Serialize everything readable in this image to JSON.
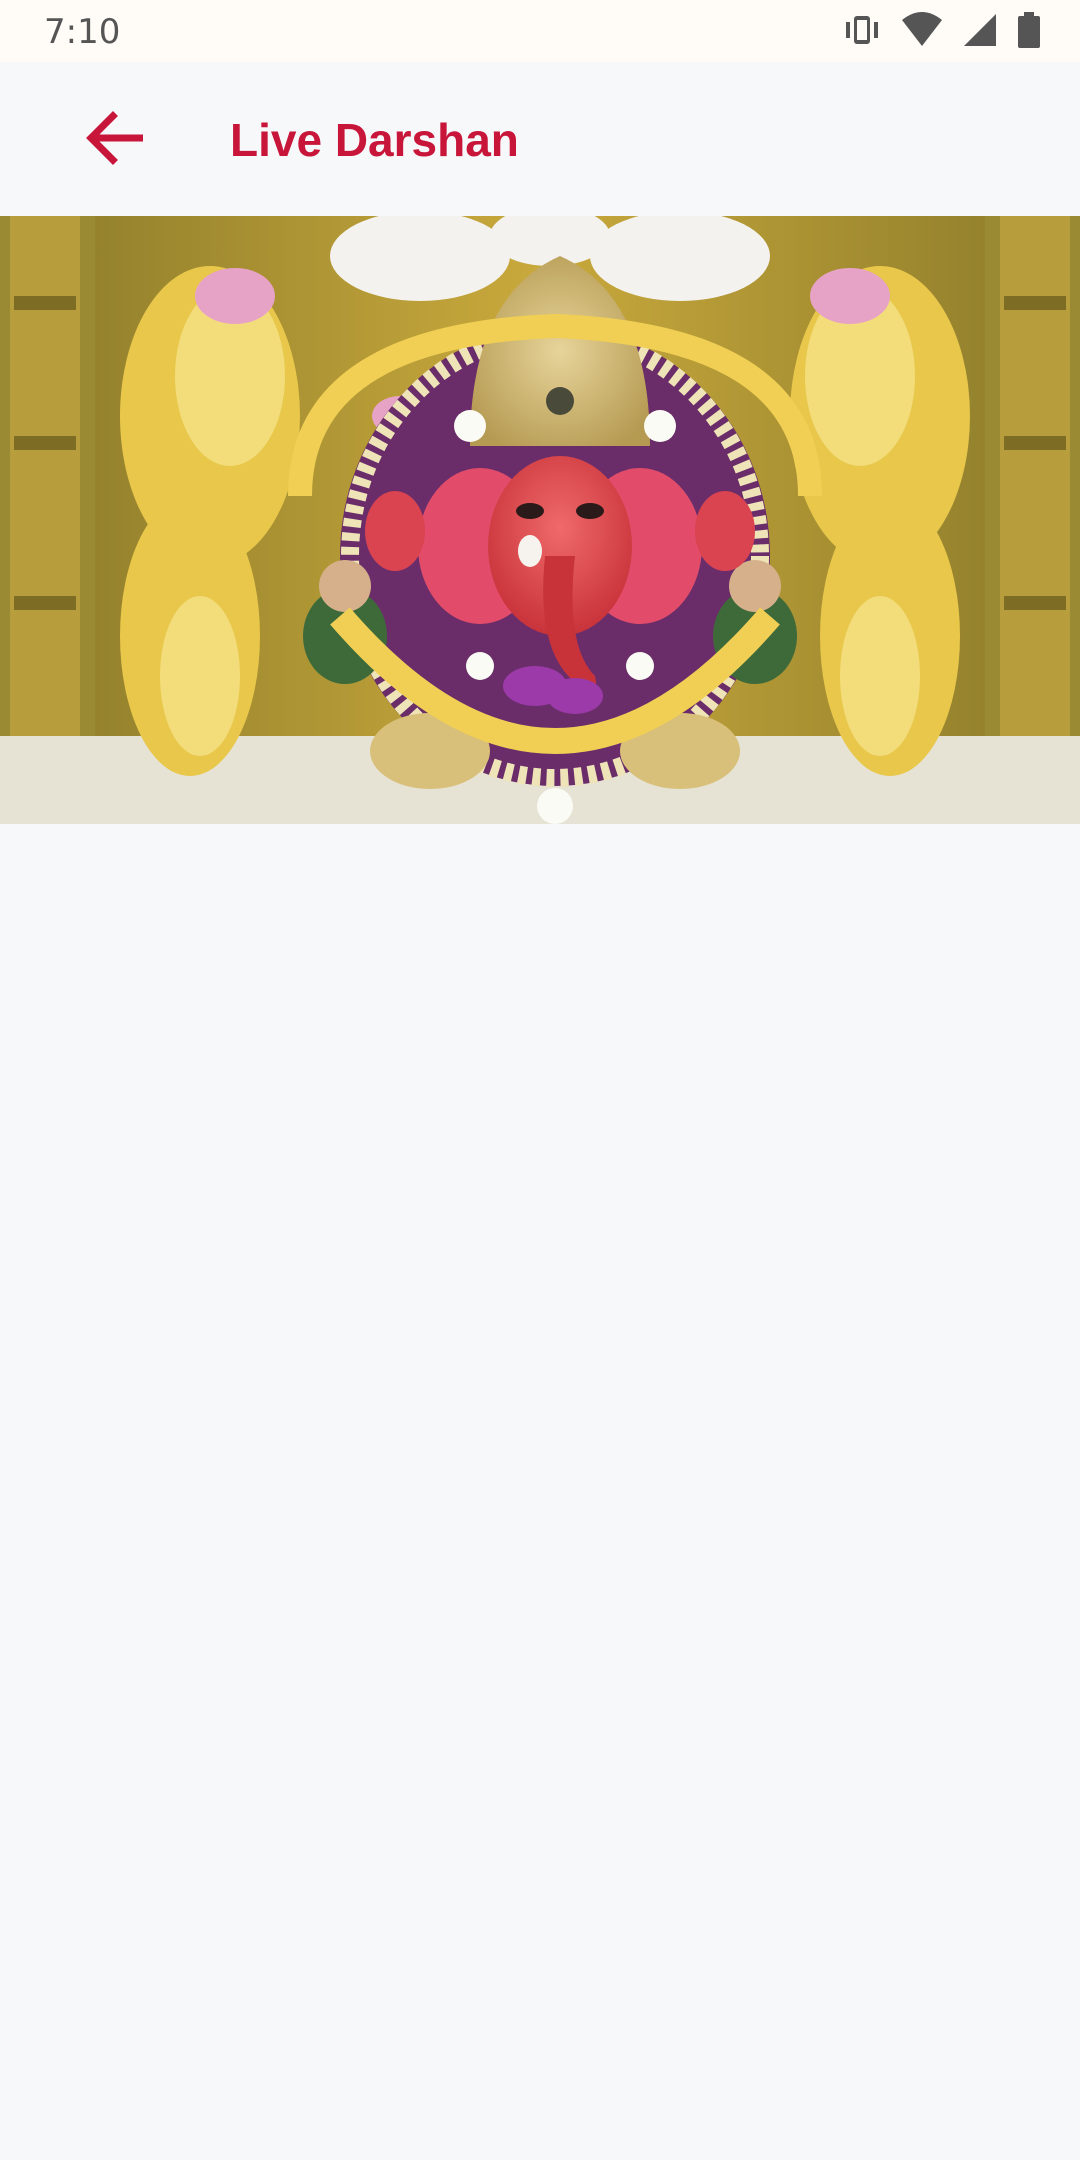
{
  "status_bar": {
    "time": "7:10",
    "icons": [
      "vibrate-icon",
      "wifi-icon",
      "cell-signal-icon",
      "battery-icon"
    ]
  },
  "app_bar": {
    "back_icon": "arrow-back-icon",
    "title": "Live Darshan"
  },
  "colors": {
    "accent": "#c8153a",
    "background": "#f7f8fa",
    "status_bar": "#fffcf8",
    "status_icons": "#555555"
  },
  "media": {
    "image": "ganesha-idol-darshan-image"
  }
}
